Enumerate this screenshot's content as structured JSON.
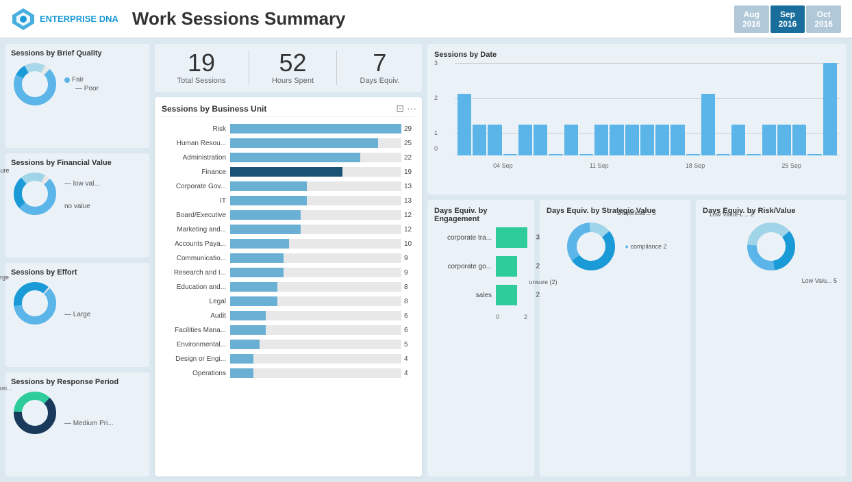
{
  "header": {
    "logo_text_1": "ENTERPRISE",
    "logo_text_2": "DNA",
    "page_title": "Work Sessions Summary",
    "months": [
      {
        "label": "Aug\n2016",
        "active": false
      },
      {
        "label": "Sep\n2016",
        "active": true
      },
      {
        "label": "Oct\n2016",
        "active": false
      }
    ]
  },
  "stats": {
    "total_sessions": "19",
    "total_sessions_label": "Total Sessions",
    "hours_spent": "52",
    "hours_spent_label": "Hours Spent",
    "days_equiv": "7",
    "days_equiv_label": "Days Equiv."
  },
  "sessions_by_brief_quality": {
    "title": "Sessions by Brief Quality",
    "labels": [
      "Fair",
      "Poor"
    ]
  },
  "sessions_by_financial_value": {
    "title": "Sessions by Financial Value",
    "labels": [
      "unsure",
      "low val...",
      "no value"
    ]
  },
  "sessions_by_effort": {
    "title": "Sessions by Effort",
    "labels": [
      "Extra-Large",
      "Large"
    ]
  },
  "sessions_by_response_period": {
    "title": "Sessions by Response Period",
    "labels": [
      "Low Priori...",
      "Medium Pri..."
    ]
  },
  "business_unit_chart": {
    "title": "Sessions by Business Unit",
    "bars": [
      {
        "label": "Risk",
        "value": 29,
        "max": 29,
        "highlighted": false
      },
      {
        "label": "Human Resou...",
        "value": 25,
        "max": 29,
        "highlighted": false
      },
      {
        "label": "Administration",
        "value": 22,
        "max": 29,
        "highlighted": false
      },
      {
        "label": "Finance",
        "value": 19,
        "max": 29,
        "highlighted": true
      },
      {
        "label": "Corporate Gov...",
        "value": 13,
        "max": 29,
        "highlighted": false
      },
      {
        "label": "IT",
        "value": 13,
        "max": 29,
        "highlighted": false
      },
      {
        "label": "Board/Executive",
        "value": 12,
        "max": 29,
        "highlighted": false
      },
      {
        "label": "Marketing and...",
        "value": 12,
        "max": 29,
        "highlighted": false
      },
      {
        "label": "Accounts Paya...",
        "value": 10,
        "max": 29,
        "highlighted": false
      },
      {
        "label": "Communicatio...",
        "value": 9,
        "max": 29,
        "highlighted": false
      },
      {
        "label": "Research and I...",
        "value": 9,
        "max": 29,
        "highlighted": false
      },
      {
        "label": "Education and...",
        "value": 8,
        "max": 29,
        "highlighted": false
      },
      {
        "label": "Legal",
        "value": 8,
        "max": 29,
        "highlighted": false
      },
      {
        "label": "Audit",
        "value": 6,
        "max": 29,
        "highlighted": false
      },
      {
        "label": "Facilities Mana...",
        "value": 6,
        "max": 29,
        "highlighted": false
      },
      {
        "label": "Environmental...",
        "value": 5,
        "max": 29,
        "highlighted": false
      },
      {
        "label": "Design or Engi...",
        "value": 4,
        "max": 29,
        "highlighted": false
      },
      {
        "label": "Operations",
        "value": 4,
        "max": 29,
        "highlighted": false
      }
    ]
  },
  "sessions_by_date": {
    "title": "Sessions by Date",
    "y_labels": [
      "0",
      "1",
      "2",
      "3"
    ],
    "x_labels": [
      "04 Sep",
      "11 Sep",
      "18 Sep",
      "25 Sep"
    ],
    "bars": [
      2,
      1,
      1,
      0,
      1,
      1,
      0,
      1,
      0,
      1,
      1,
      1,
      1,
      1,
      1,
      0,
      2,
      0,
      1,
      0,
      1,
      1,
      1,
      0,
      3
    ]
  },
  "days_equiv_engagement": {
    "title": "Days Equiv. by Engagement",
    "bars": [
      {
        "label": "corporate tra...",
        "value": 3,
        "max": 3
      },
      {
        "label": "corporate go...",
        "value": 2,
        "max": 3
      },
      {
        "label": "sales",
        "value": 2,
        "max": 3
      }
    ],
    "x_labels": [
      "0",
      "2"
    ]
  },
  "days_equiv_strategic": {
    "title": "Days Equiv. by Strategic Value",
    "labels": [
      "simplificati... 3",
      "compliance 2",
      "unsure (2)"
    ]
  },
  "days_equiv_risk": {
    "title": "Days Equiv. by Risk/Value",
    "labels": [
      "Low Value-L... 2",
      "Low Valu... 5"
    ]
  },
  "colors": {
    "accent_blue": "#1a6e9e",
    "light_blue": "#5bb5e8",
    "bar_blue": "#6ab0d4",
    "dark_bar": "#1a5276",
    "teal": "#2ecc9a",
    "bg_light": "#eaf2f8",
    "header_bg": "#ffffff"
  }
}
